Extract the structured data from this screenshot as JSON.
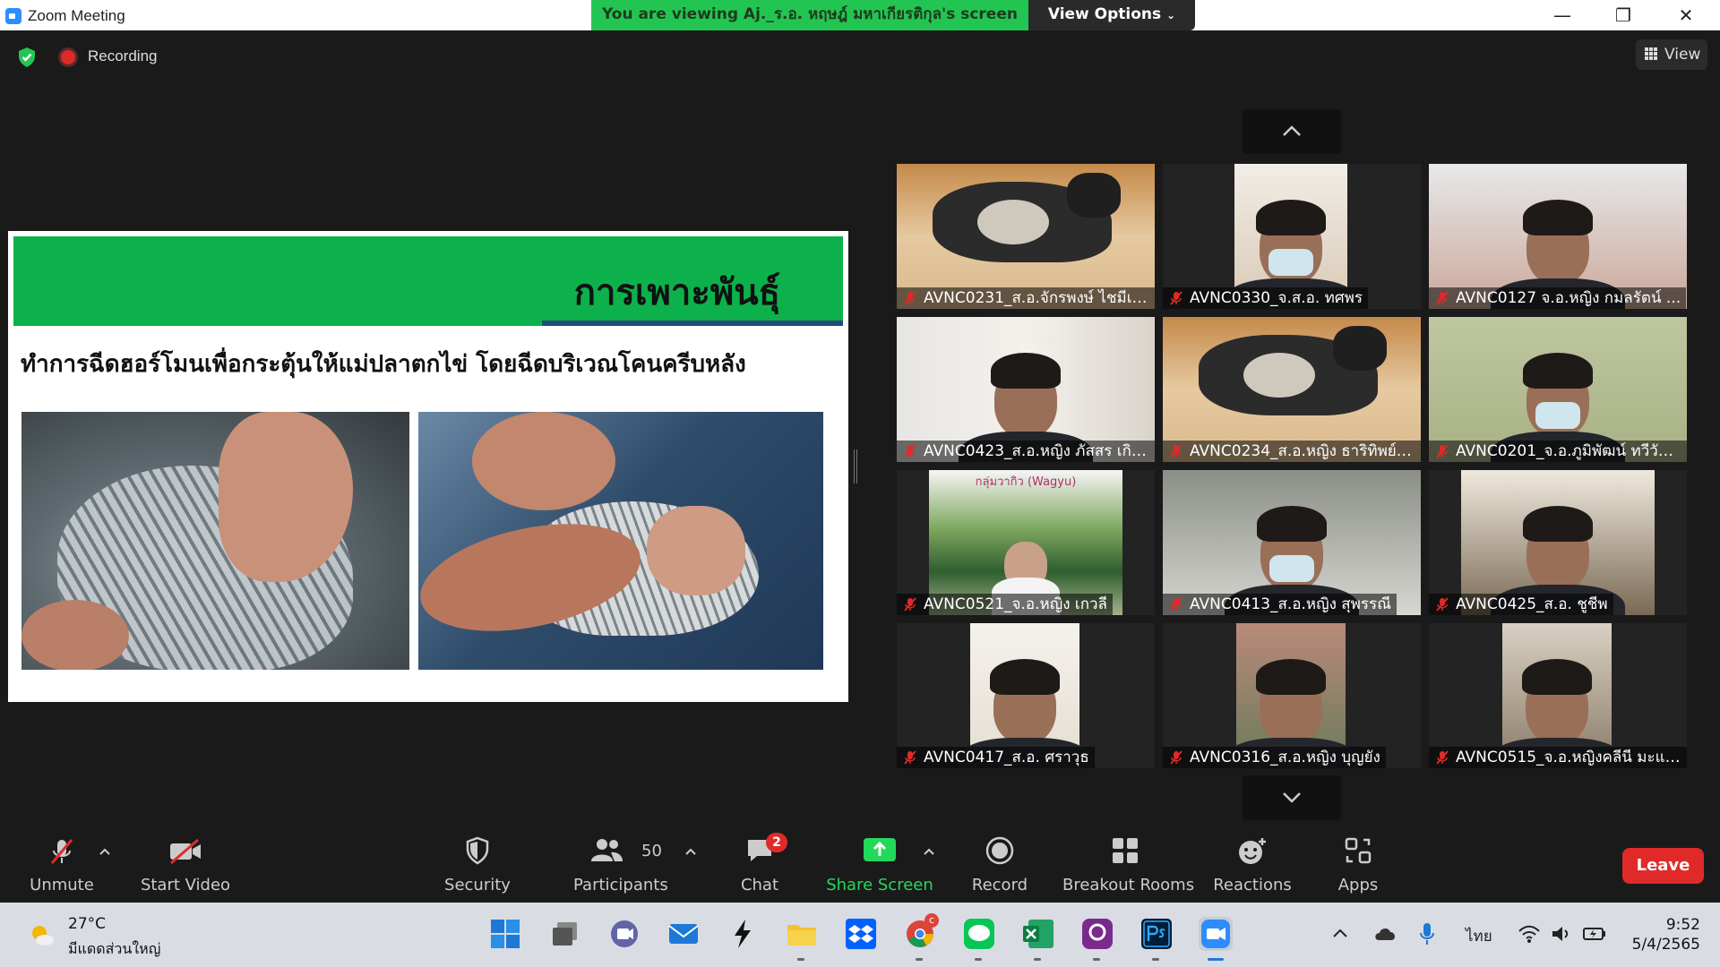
{
  "window": {
    "title": "Zoom Meeting",
    "viewing_banner": "You are viewing Aj._ร.อ. หฤษฎ์ มหาเกียรติกุล's screen",
    "view_options": "View Options"
  },
  "topbar": {
    "recording_label": "Recording",
    "view_label": "View"
  },
  "slide": {
    "title": "การเพาะพันธุ์",
    "subtitle": "ทำการฉีดฮอร์โมนเพื่อกระตุ้นให้แม่ปลาตกไข่ โดยฉีดบริเวณโคนครีบหลัง"
  },
  "participants": [
    {
      "name": "AVNC0231_ส.อ.จักรพงษ์ ไชมีเพ..."
    },
    {
      "name": "AVNC0330_จ.ส.อ. ทศพร"
    },
    {
      "name": "AVNC0127 จ.อ.หญิง กมลรัตน์ ..."
    },
    {
      "name": "AVNC0423_ส.อ.หญิง ภัสสร เกิด..."
    },
    {
      "name": "AVNC0234_ส.อ.หญิง ธาริทิพย์ ..."
    },
    {
      "name": "AVNC0201_จ.อ.ภูมิพัฒน์ ทวีวัฒ..."
    },
    {
      "name": "AVNC0521_จ.อ.หญิง เกวลี"
    },
    {
      "name": "AVNC0413_ส.อ.หญิง สุพรรณี"
    },
    {
      "name": "AVNC0425_ส.อ. ชูชีพ"
    },
    {
      "name": "AVNC0417_ส.อ. ศราวุธ"
    },
    {
      "name": "AVNC0316_ส.อ.หญิง บุญยัง"
    },
    {
      "name": "AVNC0515_จ.อ.หญิงคลีนี มะแซ..."
    }
  ],
  "wagyu_banner": "กลุ่มวากิว (Wagyu)",
  "toolbar": {
    "unmute": "Unmute",
    "start_video": "Start Video",
    "security": "Security",
    "participants": "Participants",
    "participants_count": "50",
    "chat": "Chat",
    "chat_badge": "2",
    "share_screen": "Share Screen",
    "record": "Record",
    "breakout_rooms": "Breakout Rooms",
    "reactions": "Reactions",
    "apps": "Apps",
    "leave": "Leave"
  },
  "taskbar": {
    "temperature": "27°C",
    "weather": "มีแดดส่วนใหญ่",
    "language": "ไทย",
    "time": "9:52",
    "date": "5/4/2565",
    "chrome_badge": "c"
  },
  "colors": {
    "banner_green": "#23c552",
    "share_green": "#23d95a",
    "leave_red": "#e02a2a",
    "slide_green": "#0db14b"
  }
}
